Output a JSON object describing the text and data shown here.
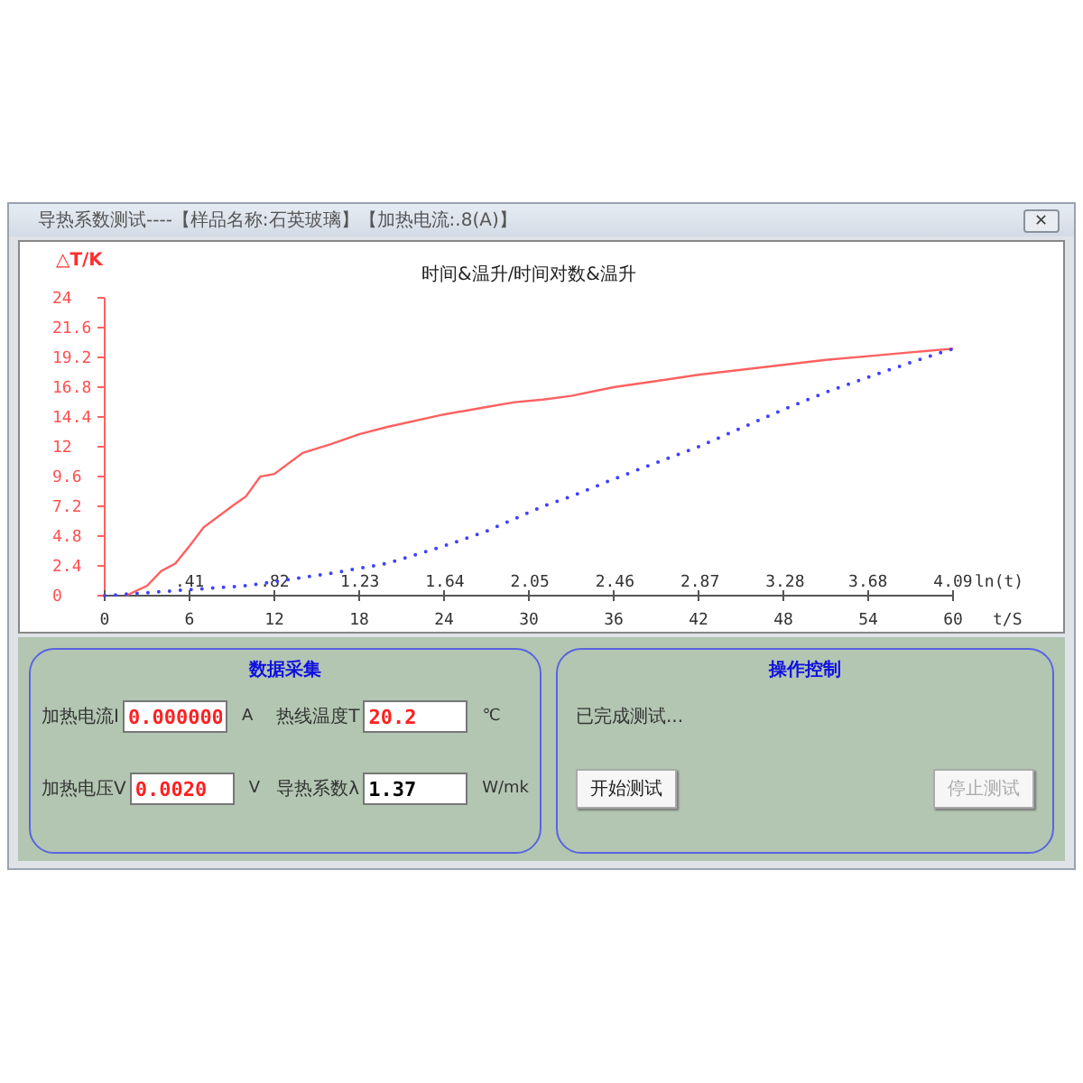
{
  "window": {
    "title": "导热系数测试----【样品名称:石英玻璃】【加热电流:.8(A)】",
    "close_label": "✕"
  },
  "chart": {
    "chart_data": {
      "type": "line",
      "title": "时间&温升/时间对数&温升",
      "ylabel": "△T/K",
      "xlabel": "t/S",
      "x2label": "ln(t)",
      "x": [
        0,
        1.5,
        3,
        4,
        5,
        6,
        7,
        9,
        10,
        11,
        12,
        14,
        16,
        18,
        20,
        24,
        27,
        29,
        31,
        33,
        36,
        39,
        42,
        45,
        48,
        51,
        54,
        57,
        60
      ],
      "series": [
        {
          "color": "#ff6060",
          "line_style": "solid",
          "values": [
            null,
            0,
            0.8,
            2,
            2.6,
            4,
            5.5,
            7.2,
            8,
            9.6,
            9.8,
            11.5,
            12.2,
            13,
            13.6,
            14.6,
            15.2,
            15.6,
            15.8,
            16.1,
            16.8,
            17.3,
            17.8,
            18.2,
            18.6,
            19,
            19.3,
            19.6,
            19.9
          ]
        },
        {
          "color": "#4040ff",
          "line_style": "dotted",
          "values": [
            0,
            null,
            null,
            null,
            null,
            null,
            null,
            null,
            0.8,
            null,
            null,
            null,
            1.8,
            null,
            2.6,
            4,
            5.2,
            6.2,
            7.2,
            8,
            9.4,
            10.7,
            12,
            13.5,
            15,
            16.4,
            17.6,
            18.8,
            19.9
          ]
        }
      ],
      "xlim": [
        0,
        60
      ],
      "ylim": [
        0,
        24
      ],
      "xticks": [
        0,
        6,
        12,
        18,
        24,
        30,
        36,
        42,
        48,
        54,
        60
      ],
      "yticks": [
        0,
        2.4,
        4.8,
        7.2,
        9.6,
        12,
        14.4,
        16.8,
        19.2,
        21.6,
        24
      ],
      "x2lim": [
        0,
        4.09
      ],
      "x2ticks": [
        {
          "value": 0.41,
          "label": ".41"
        },
        {
          "value": 0.82,
          "label": ".82"
        },
        1.23,
        1.64,
        2.05,
        2.46,
        2.87,
        3.28,
        3.68,
        4.09
      ]
    }
  },
  "data_panel": {
    "title": "数据采集",
    "fields": [
      {
        "label": "加热电流I",
        "value": "0.000000",
        "unit": "A",
        "color": "#ff2020"
      },
      {
        "label": "热线温度T",
        "value": "20.2",
        "unit": "℃",
        "color": "#ff2020"
      },
      {
        "label": "加热电压V",
        "value": "0.0020",
        "unit": "V",
        "color": "#ff2020"
      },
      {
        "label": "导热系数λ",
        "value": "1.37",
        "unit": "W/mk",
        "color": "#000000"
      }
    ]
  },
  "control_panel": {
    "title": "操作控制",
    "status": "已完成测试...",
    "buttons": [
      {
        "label": "开始测试",
        "disabled": false
      },
      {
        "label": "停止测试",
        "disabled": true
      }
    ]
  }
}
